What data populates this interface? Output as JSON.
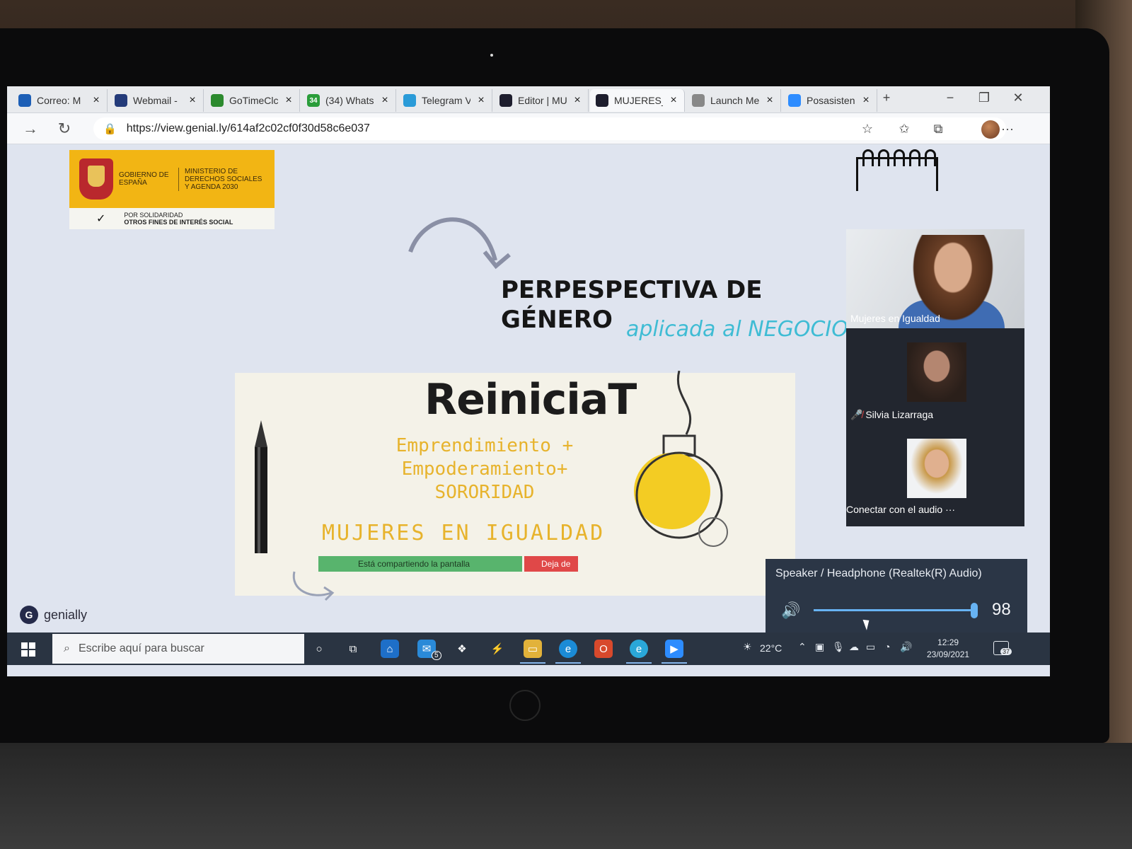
{
  "browser": {
    "tabs": [
      {
        "label": "Correo: M",
        "icon": "outlook-icon",
        "color": "#1d5fb6"
      },
      {
        "label": "Webmail -",
        "icon": "cloud-icon",
        "color": "#243b7a"
      },
      {
        "label": "GoTimeClc",
        "icon": "cloud-icon",
        "color": "#2c8a2e"
      },
      {
        "label": "(34) Whats",
        "icon": "whatsapp-icon",
        "color": "#2a9d3a",
        "badge": "34"
      },
      {
        "label": "Telegram V",
        "icon": "telegram-icon",
        "color": "#2a9bd8"
      },
      {
        "label": "Editor | MU",
        "icon": "genially-icon",
        "color": "#1e1e2e"
      },
      {
        "label": "MUJERES_",
        "icon": "genially-icon",
        "color": "#1e1e2e",
        "active": true
      },
      {
        "label": "Launch Me",
        "icon": "page-icon",
        "color": "#888888"
      },
      {
        "label": "Posasisten",
        "icon": "zoom-icon",
        "color": "#2d8cff"
      }
    ],
    "new_tab": "+",
    "close_glyph": "×",
    "url": "https://view.genial.ly/614af2c02cf0f30d58c6e037"
  },
  "slide": {
    "gov": {
      "gobierno": "GOBIERNO DE ESPAÑA",
      "ministerio": "MINISTERIO DE DERECHOS SOCIALES Y AGENDA 2030",
      "line1": "POR SOLIDARIDAD",
      "line2": "OTROS FINES DE INTERÉS SOCIAL"
    },
    "title_line1": "PERPESPECTIVA DE",
    "title_line2": "GÉNERO",
    "subtitle": "aplicada al NEGOCIO",
    "brand": "ReiniciaT",
    "tagline1": "Emprendimiento +",
    "tagline2": "Empoderamiento+",
    "tagline3": "SORORIDAD",
    "tagline4": "MUJERES EN IGUALDAD",
    "accent_yellow": "#e7b32c",
    "accent_cyan": "#3fbcd4"
  },
  "share": {
    "sharing_label": "Está compartiendo la pantalla",
    "stop_label": "Deja de"
  },
  "genially": {
    "label": "genially"
  },
  "video": {
    "participant1": "Mujeres en Igualdad",
    "participant2": "Silvia Lizarraga",
    "participant3": "Conectar con el audio ···"
  },
  "volume": {
    "device": "Speaker / Headphone (Realtek(R) Audio)",
    "value": "98",
    "level": 0.98
  },
  "taskbar": {
    "search_placeholder": "Escribe aquí para buscar",
    "weather": "22°C",
    "time": "12:29",
    "date": "23/09/2021",
    "notifications": "37",
    "mail_badge": "5"
  }
}
